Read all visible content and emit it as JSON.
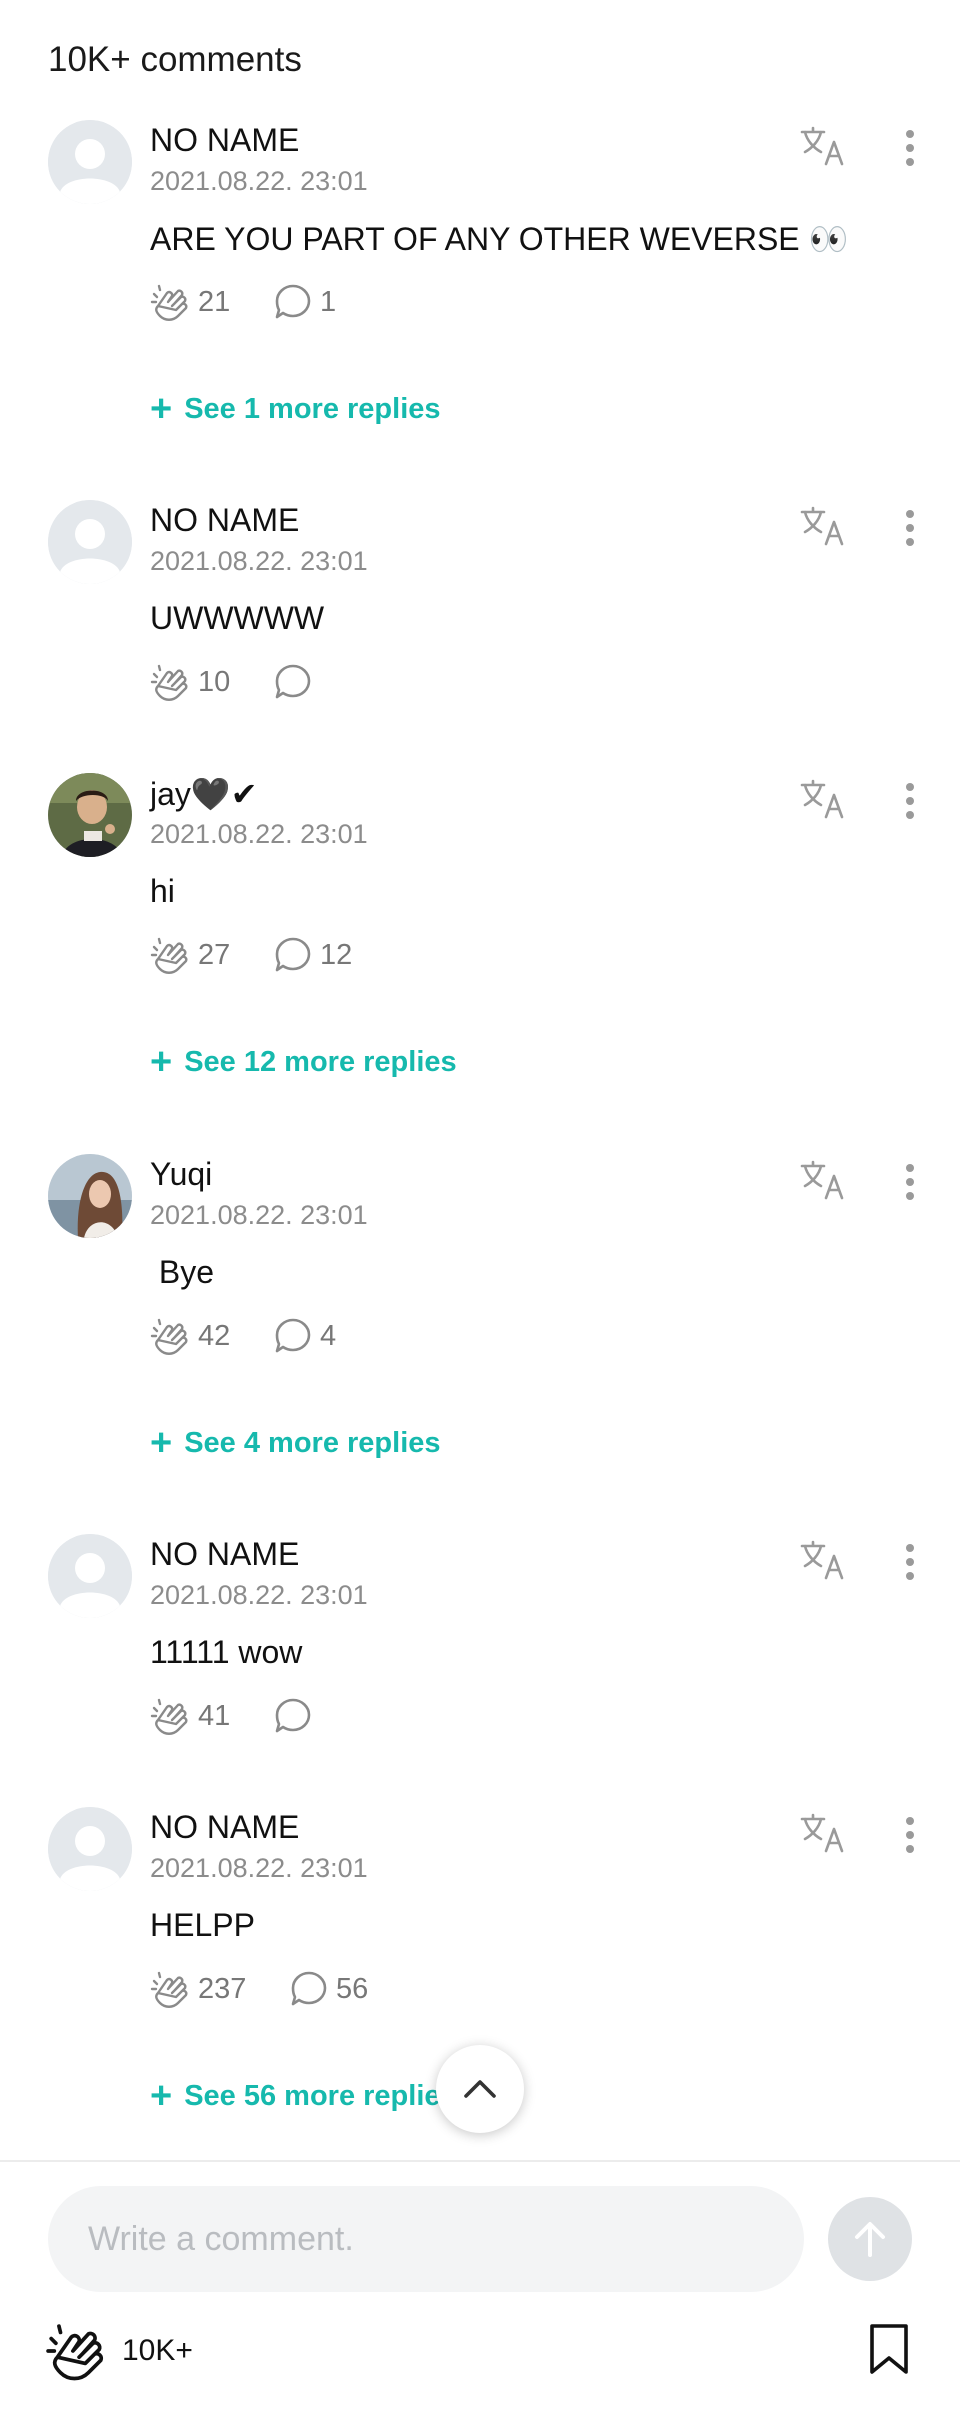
{
  "header": {
    "title": "10K+ comments"
  },
  "comments": [
    {
      "name": "NO NAME",
      "date": "2021.08.22. 23:01",
      "text": "ARE YOU PART OF ANY OTHER WEVERSE 👀",
      "likes": "21",
      "replies": "1",
      "see_more": "See 1 more replies"
    },
    {
      "name": "NO NAME",
      "date": "2021.08.22. 23:01",
      "text": "UWWWWW",
      "likes": "10",
      "replies": ""
    },
    {
      "name": "jay🖤✔",
      "date": "2021.08.22. 23:01",
      "text": "hi",
      "likes": "27",
      "replies": "12",
      "see_more": "See 12 more replies"
    },
    {
      "name": "Yuqi",
      "date": "2021.08.22. 23:01",
      "text": " Bye",
      "likes": "42",
      "replies": "4",
      "see_more": "See 4 more replies"
    },
    {
      "name": "NO NAME",
      "date": "2021.08.22. 23:01",
      "text": "11111 wow",
      "likes": "41",
      "replies": ""
    },
    {
      "name": "NO NAME",
      "date": "2021.08.22. 23:01",
      "text": "HELPP",
      "likes": "237",
      "replies": "56",
      "see_more": "See 56 more replie"
    }
  ],
  "composer": {
    "placeholder": "Write a comment."
  },
  "footer": {
    "like_count": "10K+"
  },
  "icons": {
    "like": "clap-hand-icon",
    "reply": "speech-bubble-icon",
    "translate": "translate-icon",
    "more": "more-vertical-icon",
    "scroll_top": "chevron-up-icon",
    "send": "arrow-up-icon",
    "bookmark": "bookmark-icon"
  },
  "colors": {
    "accent": "#16b9ad",
    "muted": "#8c8c8c",
    "input_bg": "#f3f4f5"
  }
}
